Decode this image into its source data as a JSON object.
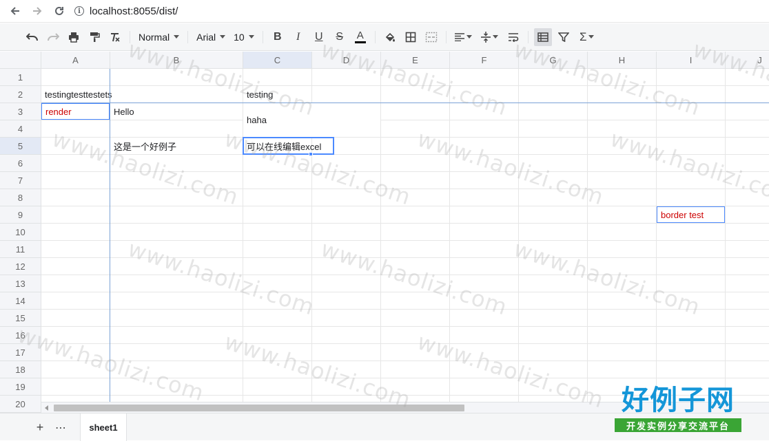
{
  "browser": {
    "url": "localhost:8055/dist/",
    "info_icon": "i"
  },
  "toolbar": {
    "font_format": "Normal",
    "font_family": "Arial",
    "font_size": "10",
    "bold_label": "B",
    "italic_label": "I",
    "underline_label": "U",
    "strike_label": "S",
    "text_color_label": "A",
    "sum_label": "Σ",
    "text_color": "#000000"
  },
  "columns": [
    "A",
    "B",
    "C",
    "D",
    "E",
    "F",
    "G",
    "H",
    "I",
    "J"
  ],
  "rows": [
    "1",
    "2",
    "3",
    "4",
    "5",
    "6",
    "7",
    "8",
    "9",
    "10",
    "11",
    "12",
    "13",
    "14",
    "15",
    "16",
    "17",
    "18",
    "19",
    "20"
  ],
  "selected": {
    "column": "C",
    "row": "5"
  },
  "cells": {
    "A2": "testingtesttestetst",
    "C2": "testing",
    "A3": "render",
    "B3": "Hello",
    "C3": "haha",
    "B5": "这是一个好例子",
    "C5": "可以在线编辑excel",
    "I9": "border test"
  },
  "sheets": [
    {
      "name": "sheet1",
      "active": true
    }
  ],
  "bottom": {
    "add": "+",
    "menu": "⋯"
  },
  "watermark": {
    "text": "www.haolizi.com",
    "brand": "好例子网",
    "tagline": "开发实例分享交流平台"
  },
  "colors": {
    "accent": "#4b89ff",
    "freeze": "#7aa2d6",
    "red_text": "#cc0000",
    "brand_blue": "#1496d8",
    "brand_green": "#3aa535"
  }
}
